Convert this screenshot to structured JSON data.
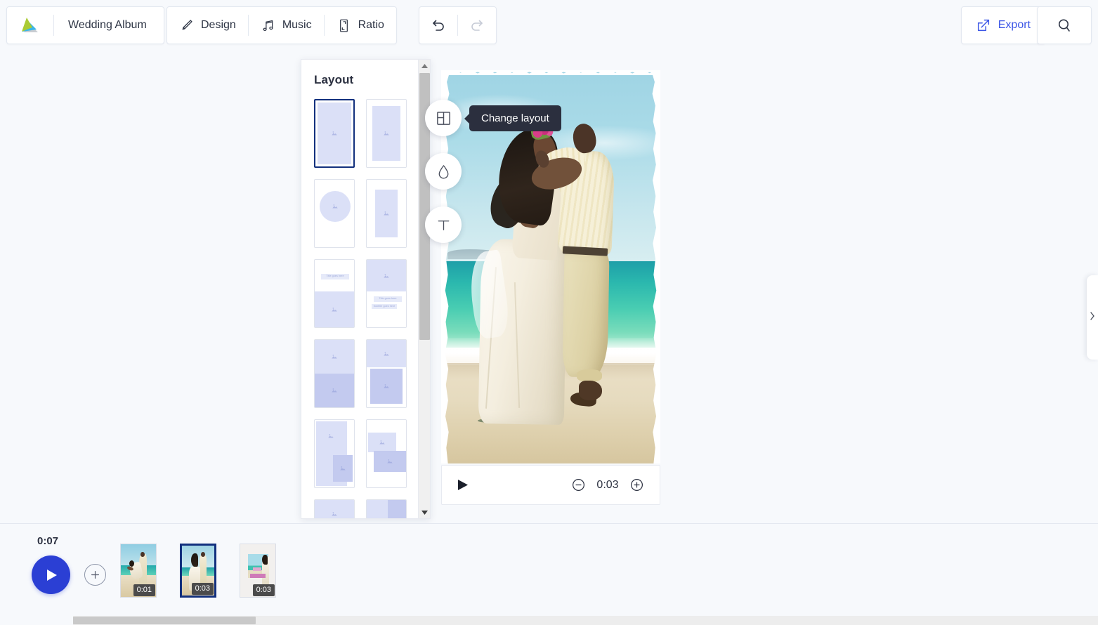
{
  "app": {
    "project_name": "Wedding Album",
    "logo_name": "app-logo"
  },
  "toolbar": {
    "tools": [
      {
        "label": "Design",
        "icon": "brush-icon"
      },
      {
        "label": "Music",
        "icon": "music-note-icon"
      },
      {
        "label": "Ratio",
        "icon": "aspect-ratio-icon"
      }
    ],
    "undo_label": "Undo",
    "redo_label": "Redo",
    "undo_enabled": "true",
    "redo_enabled": "false",
    "export_label": "Export",
    "export_color": "#3b55e6",
    "search_label": "Search"
  },
  "layout_panel": {
    "title": "Layout",
    "selected_index": 0,
    "placeholder_title": "Title goes here",
    "placeholder_subtitle": "Subtitle goes here",
    "options": [
      {
        "name": "full-bleed-single",
        "selected": "true"
      },
      {
        "name": "inset-single",
        "selected": "false"
      },
      {
        "name": "circle-single",
        "selected": "false"
      },
      {
        "name": "centered-portrait",
        "selected": "false"
      },
      {
        "name": "title-over-photo",
        "selected": "false"
      },
      {
        "name": "photo-over-title-subtitle",
        "selected": "false"
      },
      {
        "name": "two-stacked-equal",
        "selected": "false"
      },
      {
        "name": "top-photo-inset-bottom",
        "selected": "false"
      },
      {
        "name": "overlap-two-photo",
        "selected": "false"
      },
      {
        "name": "staggered-two-photo",
        "selected": "false"
      },
      {
        "name": "wide-top-photo",
        "selected": "false"
      },
      {
        "name": "split-vertical-two",
        "selected": "false"
      }
    ]
  },
  "canvas": {
    "tools": [
      {
        "name": "change-layout",
        "icon": "layout-grid-icon",
        "tooltip": "Change layout",
        "tooltip_visible": "true"
      },
      {
        "name": "filters",
        "icon": "droplet-icon",
        "tooltip": "Filters",
        "tooltip_visible": "false"
      },
      {
        "name": "text",
        "icon": "text-icon",
        "tooltip": "Text",
        "tooltip_visible": "false"
      }
    ],
    "photo_alt": "Bride and groom embracing on a tropical beach"
  },
  "playback": {
    "play_label": "Play",
    "duration": "0:03",
    "decrease_label": "Decrease duration",
    "increase_label": "Increase duration"
  },
  "right_panel": {
    "expand_label": "Expand panel",
    "chevron": "›"
  },
  "timeline": {
    "total_duration": "0:07",
    "play_label": "Play",
    "add_label": "Add media",
    "clips": [
      {
        "duration": "0:01",
        "selected": "false",
        "thumb": "beach-carry"
      },
      {
        "duration": "0:03",
        "selected": "true",
        "thumb": "beach-embrace"
      },
      {
        "duration": "0:03",
        "selected": "false",
        "thumb": "text-card"
      }
    ]
  }
}
